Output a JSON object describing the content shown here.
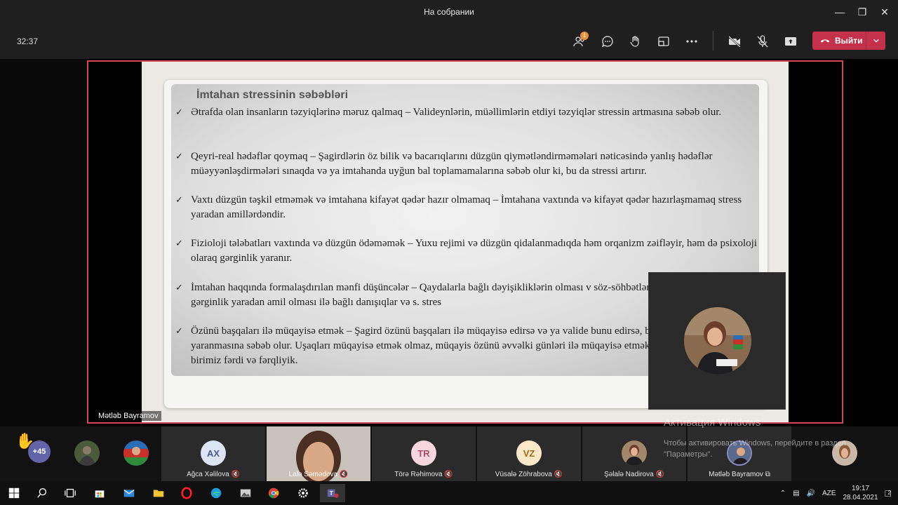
{
  "window": {
    "title": "На собрании"
  },
  "meeting": {
    "timer": "32:37",
    "participants_badge": "1",
    "leave_label": "Выйти"
  },
  "slide": {
    "heading": "İmtahan stressinin səbəbləri",
    "bullets": [
      "Ətrafda olan insanların təzyiqlərinə məruz qalmaq – Valideynlərin, müəllimlərin etdiyi təzyiqlər stressin artmasına səbəb olur.",
      "Qeyri-real hədəflər qoymaq – Şagirdlərin öz bilik və bacarıqlarını düzgün qiymətləndirməməlari nəticəsində yanlış hədəflər müəyyənləşdirmələri sınaqda və ya imtahanda uyğun bal toplamamalarına səbəb olur ki, bu da stressi artırır.",
      "Vaxtı düzgün təşkil etməmək və imtahana kifayət qədər hazır olmamaq – İmtahana vaxtında və kifayət qədər hazırlaşmamaq stress yaradan amillərdəndir.",
      "Fizioloji tələbatları vaxtında və düzgün ödəməmək – Yuxu rejimi və düzgün qidalanmadıqda həm orqanizm zəifləyir, həm də psixoloji olaraq gərginlik yaranır.",
      "İmtahan haqqında formalaşdırılan mənfi düşüncələr – Qaydalarla bağlı dəyişikliklərin olması v söz-söhbətlərin olması, imtahanın gərginlik yaradan amil olması ilə bağlı danışıqlar və s. stres",
      "Özünü başqaları ilə müqayisə etmək – Şagird özünü başqaları ilə müqayisə edirsə və ya valide bunu edirsə, bu hal stressin yaranmasına səbəb olur. Uşaqları müqayisə etmək olmaz, müqayis özünü əvvəlki günləri ilə müqayisə etməklə ola bilər. Çünki biz hər birimiz fərdi və fərqliyik."
    ]
  },
  "presenter": {
    "name": "Mətləb Bayramov"
  },
  "strip": {
    "overflow_count": "+45",
    "participants": [
      {
        "initials": "AX",
        "name": "Ağca Xəlilova"
      },
      {
        "initials": "",
        "name": "Lalə Səmədova"
      },
      {
        "initials": "TR",
        "name": "Törə Rəhimova"
      },
      {
        "initials": "VZ",
        "name": "Vüsalə Zöhrabova"
      },
      {
        "initials": "",
        "name": "Şəlalə Nadirova"
      },
      {
        "initials": "",
        "name": "Mətləb Bayramov"
      }
    ]
  },
  "activation": {
    "title": "Активация Windows",
    "subtitle": "Чтобы активировать Windows, перейдите в раздел \"Параметры\"."
  },
  "taskbar": {
    "language": "AZE",
    "time": "19:17",
    "date": "28.04.2021",
    "notifications": "2"
  },
  "colors": {
    "accent_leave": "#c4314b",
    "share_border": "#d0455a",
    "teams_purple": "#6264a7"
  }
}
